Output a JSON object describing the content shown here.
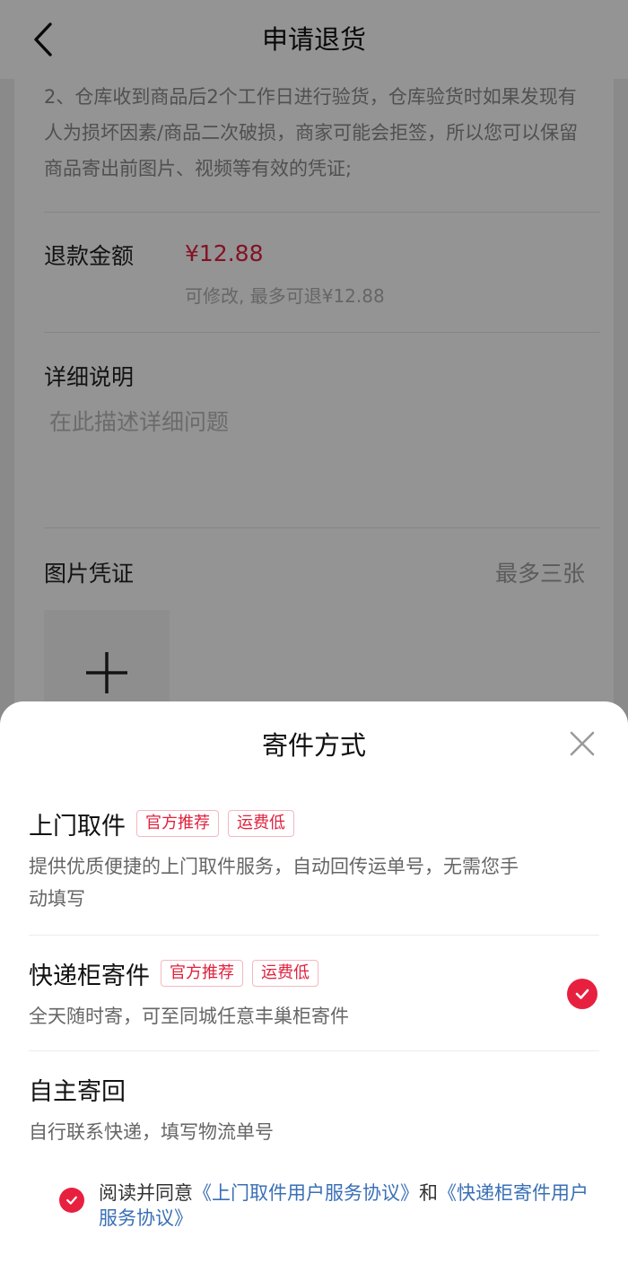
{
  "header": {
    "title": "申请退货"
  },
  "notice": {
    "text": "2、仓库收到商品后2个工作日进行验货，仓库验货时如果发现有人为损坏因素/商品二次破损，商家可能会拒签，所以您可以保留商品寄出前图片、视频等有效的凭证;"
  },
  "refund": {
    "label": "退款金额",
    "amount": "¥12.88",
    "hint": "可修改, 最多可退¥12.88"
  },
  "detail": {
    "label": "详细说明",
    "placeholder": "在此描述详细问题"
  },
  "photos": {
    "label": "图片凭证",
    "limit": "最多三张"
  },
  "sheet": {
    "title": "寄件方式",
    "options": [
      {
        "name": "上门取件",
        "tags": [
          "官方推荐",
          "运费低"
        ],
        "desc": "提供优质便捷的上门取件服务，自动回传运单号，无需您手动填写",
        "selected": false
      },
      {
        "name": "快递柜寄件",
        "tags": [
          "官方推荐",
          "运费低"
        ],
        "desc": "全天随时寄，可至同城任意丰巢柜寄件",
        "selected": true
      },
      {
        "name": "自主寄回",
        "tags": [],
        "desc": "自行联系快递，填写物流单号",
        "selected": false
      }
    ],
    "agreement": {
      "prefix": "阅读并同意",
      "link1": "《上门取件用户服务协议》",
      "middle": "和",
      "link2": "《快递柜寄件用户服务协议》",
      "checked": true
    }
  },
  "colors": {
    "accent": "#e8203f",
    "price": "#e0213e",
    "link": "#3a6fb5"
  }
}
